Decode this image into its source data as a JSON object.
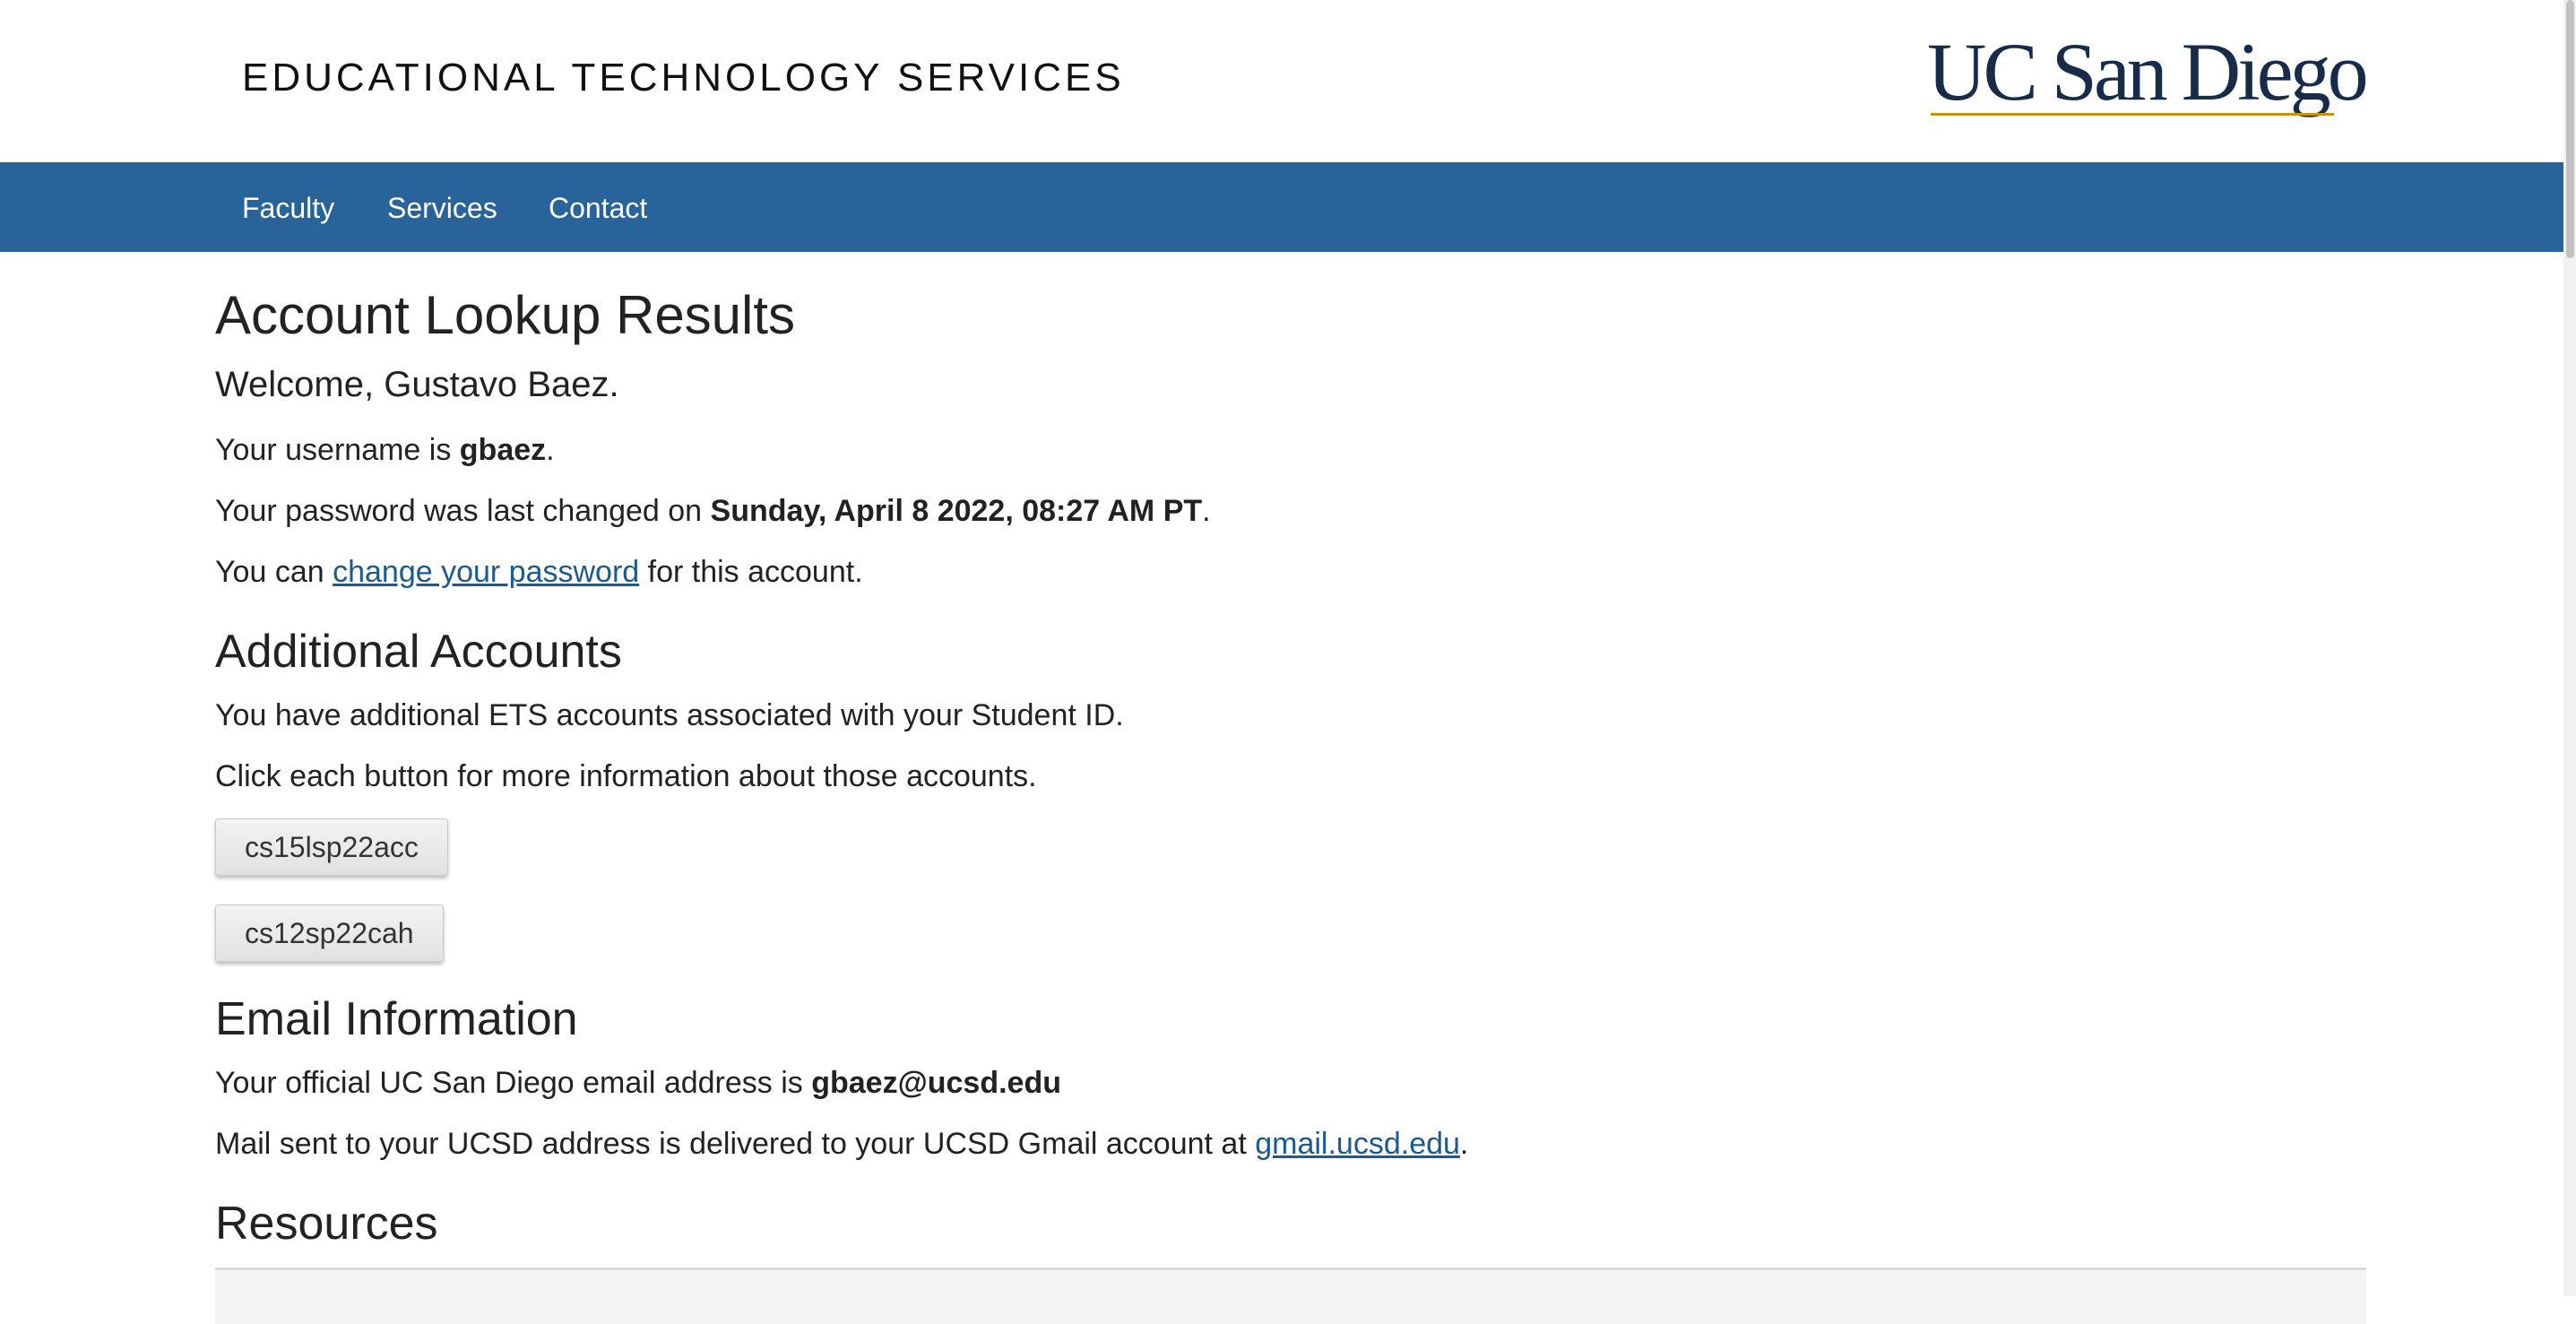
{
  "header": {
    "site_title": "EDUCATIONAL TECHNOLOGY SERVICES",
    "logo_text": "UC San Diego"
  },
  "nav": {
    "items": [
      {
        "label": "Faculty"
      },
      {
        "label": "Services"
      },
      {
        "label": "Contact"
      }
    ]
  },
  "main": {
    "title": "Account Lookup Results",
    "welcome": "Welcome, Gustavo Baez.",
    "username": {
      "prefix": "Your username is ",
      "value": "gbaez",
      "suffix": "."
    },
    "password_changed": {
      "prefix": "Your password was last changed on ",
      "value": "Sunday, April 8 2022, 08:27 AM PT",
      "suffix": "."
    },
    "change_password": {
      "prefix": "You can ",
      "link": "change your password",
      "suffix": " for this account."
    }
  },
  "additional_accounts": {
    "heading": "Additional Accounts",
    "text1": "You have additional ETS accounts associated with your Student ID.",
    "text2": "Click each button for more information about those accounts.",
    "buttons": [
      {
        "label": "cs15lsp22acc"
      },
      {
        "label": "cs12sp22cah"
      }
    ]
  },
  "email": {
    "heading": "Email Information",
    "official": {
      "prefix": "Your official UC San Diego email address is ",
      "value": "gbaez@ucsd.edu"
    },
    "delivery": {
      "prefix": "Mail sent to your UCSD address is delivered to your UCSD Gmail account at ",
      "link": "gmail.ucsd.edu",
      "suffix": "."
    }
  },
  "resources": {
    "heading": "Resources"
  },
  "colors": {
    "nav_bg": "#286399",
    "link": "#1a5a8f",
    "logo_navy": "#182b49",
    "logo_gold": "#c69214"
  }
}
